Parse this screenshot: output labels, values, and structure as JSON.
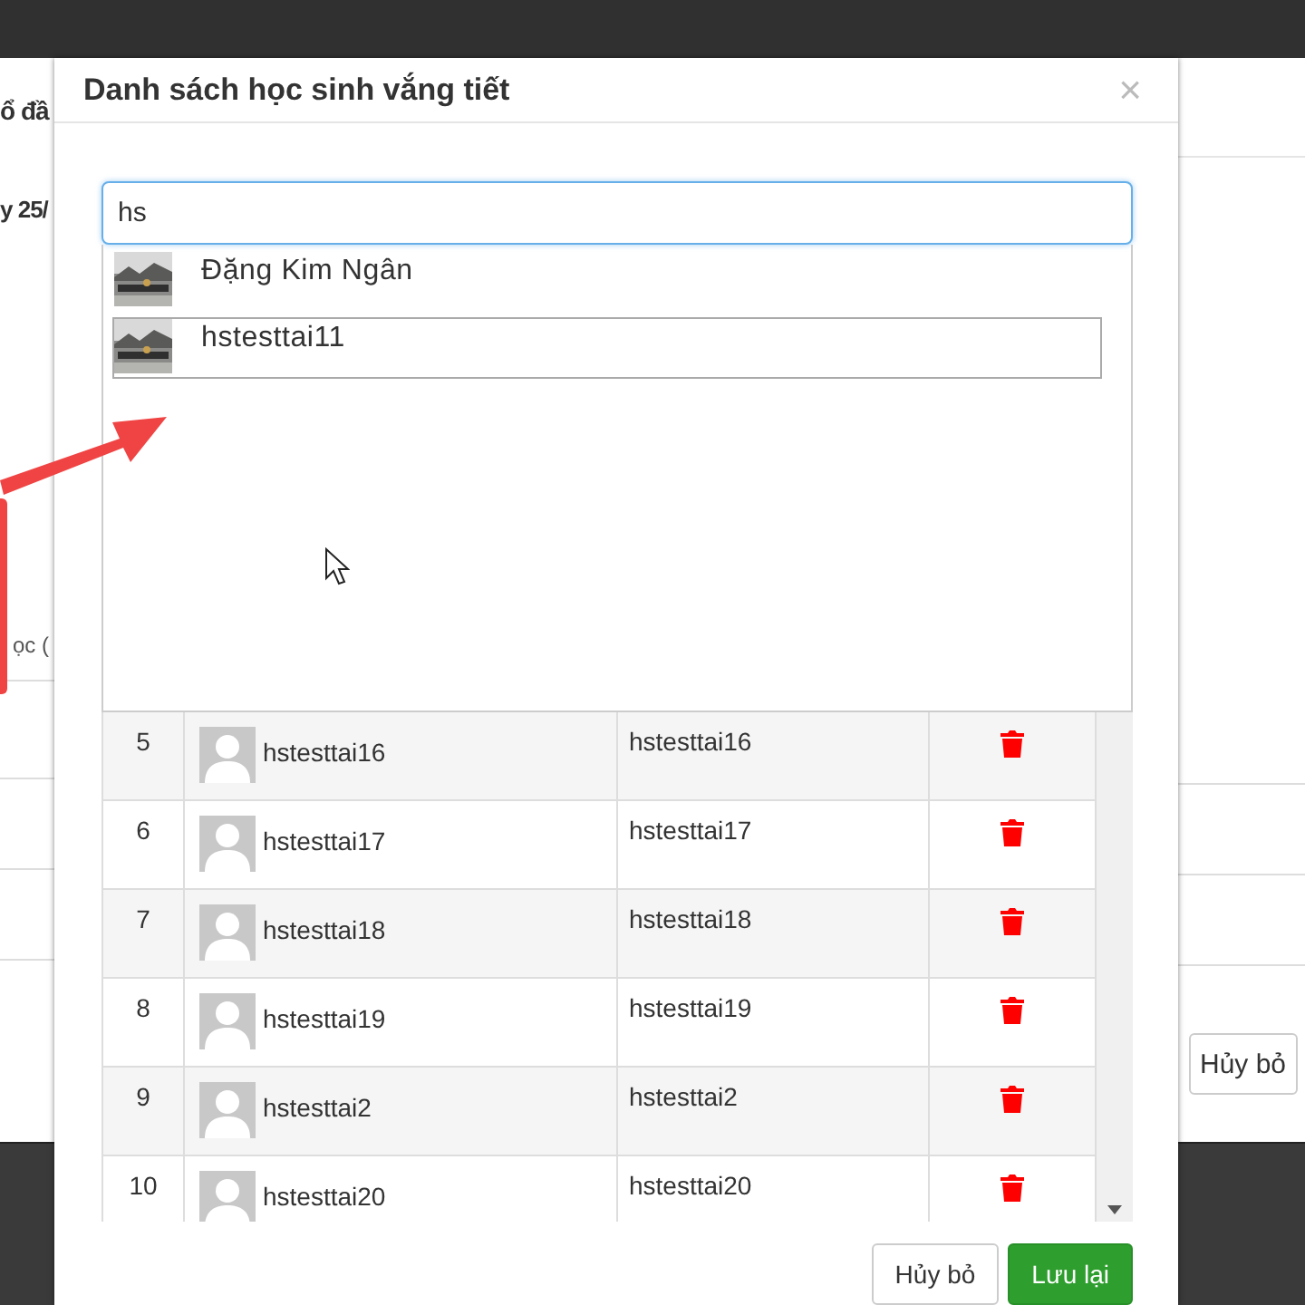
{
  "background_page": {
    "title_fragment": "ổ đầ",
    "date_fragment": "y 25/",
    "label_fragment": "ọc (",
    "cancel_button": "Hủy bỏ"
  },
  "dialog": {
    "title": "Danh sách học sinh vắng tiết",
    "close": "×",
    "search": {
      "value": "hs"
    },
    "suggestions": [
      {
        "name": "Đặng Kim Ngân",
        "selected": false
      },
      {
        "name": "hstesttai11",
        "selected": true
      }
    ],
    "rows": [
      {
        "index": "5",
        "name": "hstesttai16",
        "username": "hstesttai16"
      },
      {
        "index": "6",
        "name": "hstesttai17",
        "username": "hstesttai17"
      },
      {
        "index": "7",
        "name": "hstesttai18",
        "username": "hstesttai18"
      },
      {
        "index": "8",
        "name": "hstesttai19",
        "username": "hstesttai19"
      },
      {
        "index": "9",
        "name": "hstesttai2",
        "username": "hstesttai2"
      },
      {
        "index": "10",
        "name": "hstesttai20",
        "username": "hstesttai20"
      }
    ],
    "buttons": [
      {
        "label": "Hủy bỏ",
        "kind": "secondary"
      },
      {
        "label": "Lưu lại",
        "kind": "primary"
      }
    ]
  }
}
